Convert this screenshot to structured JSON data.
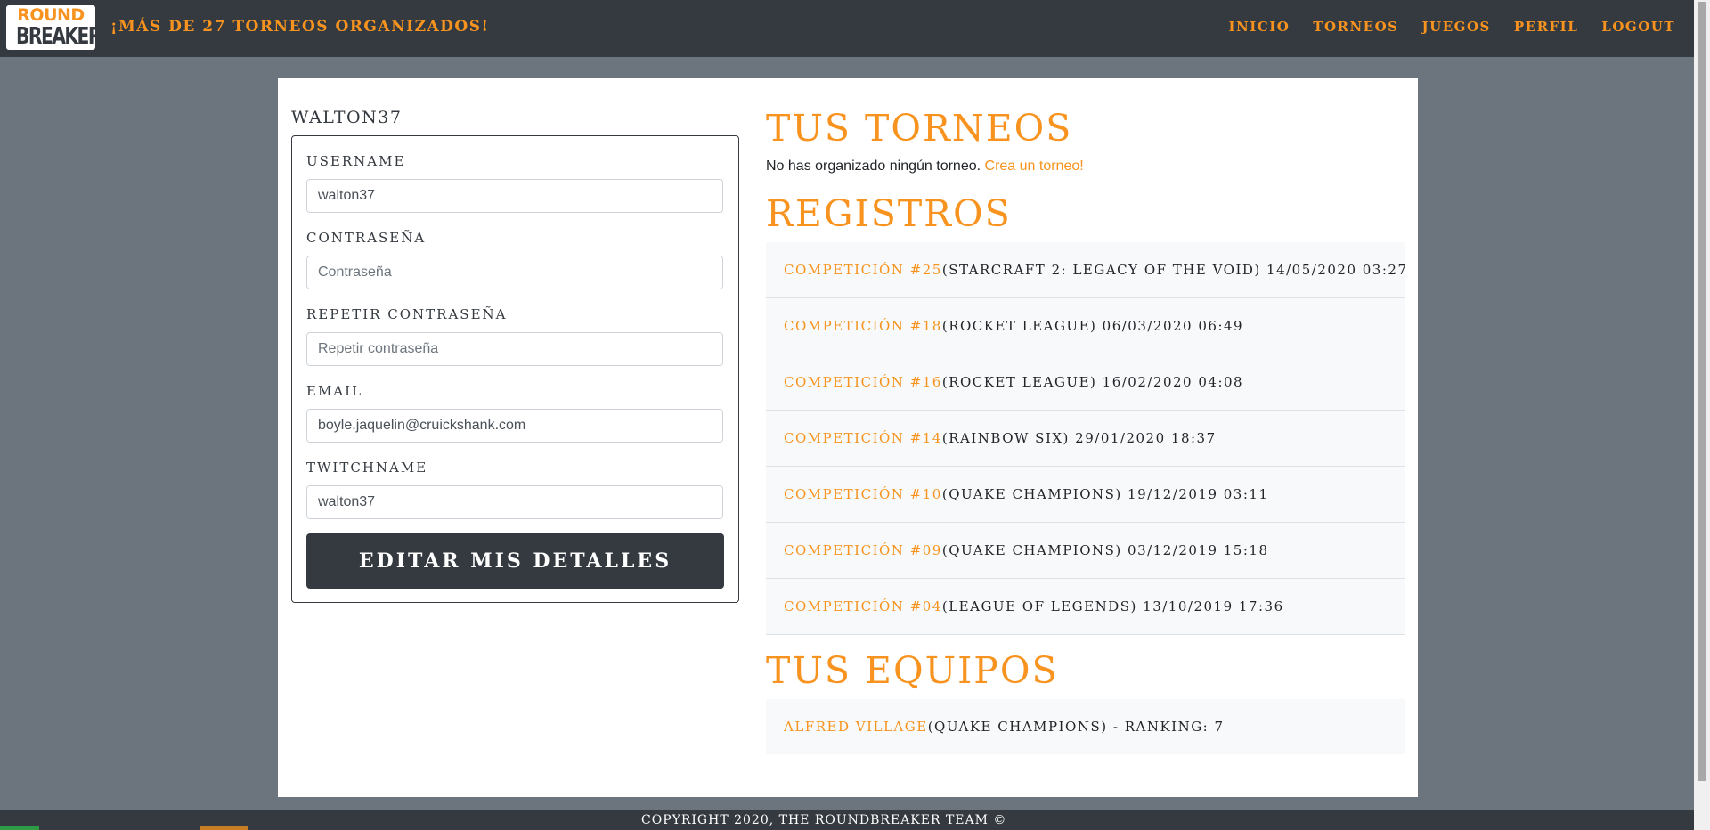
{
  "header": {
    "logo_top": "ROUND",
    "logo_bottom": "BREAKER",
    "tagline": "¡MÁS DE 27 TORNEOS ORGANIZADOS!",
    "nav": [
      "INICIO",
      "TORNEOS",
      "JUEGOS",
      "PERFIL",
      "LOGOUT"
    ],
    "accent_color": "#f7931e",
    "bar_color": "#343a40"
  },
  "profile": {
    "heading": "WALTON37",
    "fields": [
      {
        "label": "USERNAME",
        "value": "walton37",
        "placeholder": ""
      },
      {
        "label": "CONTRASEÑA",
        "value": "",
        "placeholder": "Contraseña"
      },
      {
        "label": "REPETIR CONTRASEÑA",
        "value": "",
        "placeholder": "Repetir contraseña"
      },
      {
        "label": "EMAIL",
        "value": "boyle.jaquelin@cruickshank.com",
        "placeholder": ""
      },
      {
        "label": "TWITCHNAME",
        "value": "walton37",
        "placeholder": ""
      }
    ],
    "submit_label": "EDITAR MIS DETALLES"
  },
  "tournaments": {
    "title": "TUS TORNEOS",
    "empty_text": "No has organizado ningún torneo.",
    "create_link": "Crea un torneo!"
  },
  "registrations": {
    "title": "REGISTROS",
    "items": [
      {
        "link": "COMPETICIÓN #25",
        "rest": "(STARCRAFT 2: LEGACY OF THE VOID) 14/05/2020 03:27"
      },
      {
        "link": "COMPETICIÓN #18",
        "rest": "(ROCKET LEAGUE) 06/03/2020 06:49"
      },
      {
        "link": "COMPETICIÓN #16",
        "rest": "(ROCKET LEAGUE) 16/02/2020 04:08"
      },
      {
        "link": "COMPETICIÓN #14",
        "rest": "(RAINBOW SIX) 29/01/2020 18:37"
      },
      {
        "link": "COMPETICIÓN #10",
        "rest": "(QUAKE CHAMPIONS) 19/12/2019 03:11"
      },
      {
        "link": "COMPETICIÓN #09",
        "rest": "(QUAKE CHAMPIONS) 03/12/2019 15:18"
      },
      {
        "link": "COMPETICIÓN #04",
        "rest": "(LEAGUE OF LEGENDS) 13/10/2019 17:36"
      }
    ]
  },
  "teams": {
    "title": "TUS EQUIPOS",
    "items": [
      {
        "link": "ALFRED VILLAGE",
        "rest": "(QUAKE CHAMPIONS) - RANKING: 7"
      }
    ]
  },
  "footer": {
    "text": "COPYRIGHT 2020, THE ROUNDBREAKER TEAM ©"
  }
}
